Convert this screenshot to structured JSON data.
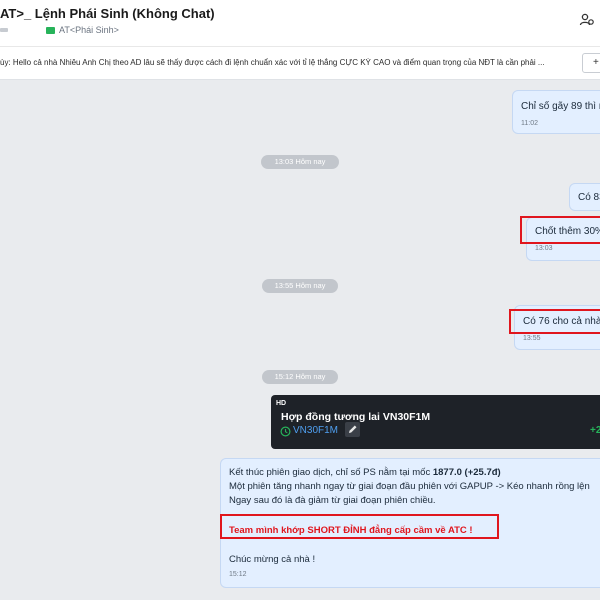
{
  "header": {
    "title": "AT>_ Lệnh Phái Sinh (Không Chat)",
    "tag_label": "AT<Phái Sinh>"
  },
  "pinned": {
    "text": "ùy: Hello cả nhà Nhiêu Anh Chị theo AD lâu sẽ thấy được cách đi lệnh chuẩn xác với tỉ lệ thắng CỰC KỲ CAO và điểm quan trọng của NĐT là cần phải ...",
    "add_label": "+"
  },
  "messages": [
    {
      "text": "Chỉ số gãy 89 thì n",
      "time": "11:02"
    },
    {
      "separator": "13:03 Hôm nay"
    },
    {
      "text": "Có 83"
    },
    {
      "text": "Chốt thêm 30%",
      "time": "13:03"
    },
    {
      "separator": "13:55 Hôm nay"
    },
    {
      "text": "Có 76 cho cả nhà",
      "time": "13:55"
    },
    {
      "separator": "15:12 Hôm nay"
    }
  ],
  "card": {
    "badge": "HD",
    "title": "Hợp đồng tương lai VN30F1M",
    "ticker": "VN30F1M",
    "change": "+2"
  },
  "final_message": {
    "line1_a": "Kết thúc phiên giao dịch, chỉ số PS nằm tại mốc ",
    "line1_b": "1877.0 (+25.7đ)",
    "line2": "Một phiên tăng nhanh ngay từ giai đoạn đầu phiên với GAPUP -> Kéo nhanh rồng lện",
    "line3": "Ngay sau đó là đà giảm từ giai đoạn phiên chiều.",
    "highlight": "Team mình khớp SHORT ĐỈNH đẳng cấp cầm về ATC !",
    "closing": "Chúc mừng cả nhà !",
    "time": "15:12"
  },
  "colors": {
    "bubble": "#e3efff",
    "highlight_border": "#e0161e",
    "card_bg": "#1e2228",
    "ticker": "#4f9ff0",
    "positive": "#27b35a"
  },
  "icons": [
    "group-settings-icon",
    "tag-icon",
    "clock-icon",
    "pencil-icon"
  ]
}
